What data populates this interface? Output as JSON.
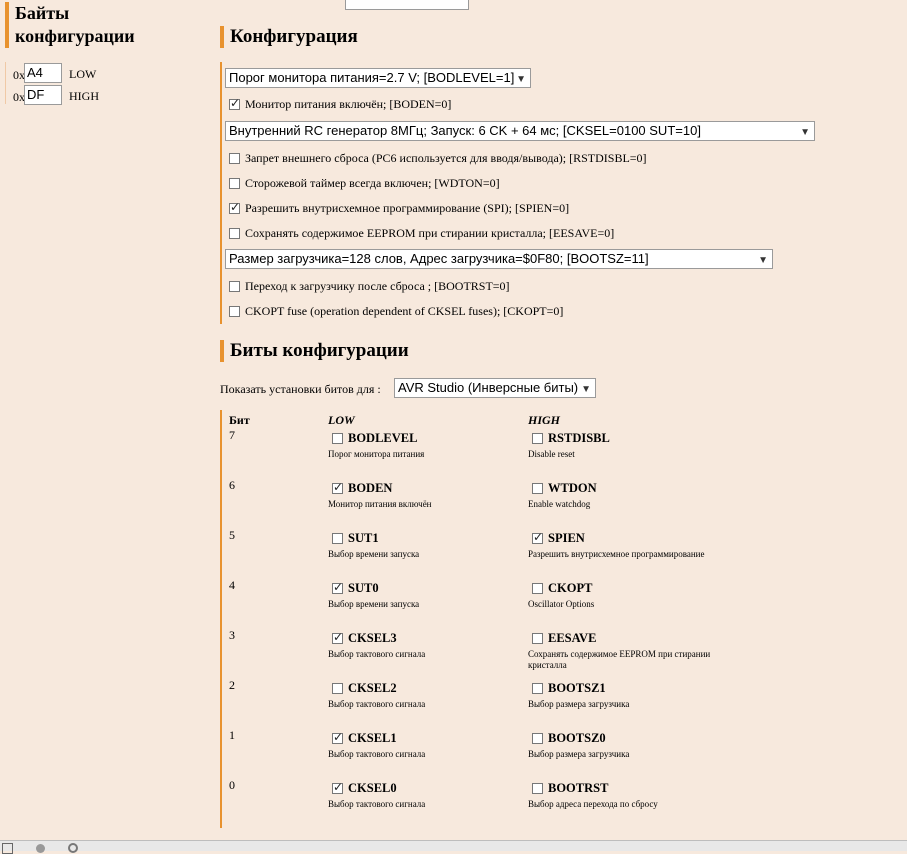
{
  "left_panel": {
    "title": "Байты конфигурации",
    "bytes": [
      {
        "prefix": "0x",
        "value": "A4",
        "label": "LOW"
      },
      {
        "prefix": "0x",
        "value": "DF",
        "label": "HIGH"
      }
    ]
  },
  "config": {
    "title": "Конфигурация",
    "bodlevel_select": "Порог монитора питания=2.7 V; [BODLEVEL=1]",
    "boden": {
      "label": "Монитор питания включён; [BODEN=0]",
      "checked": true
    },
    "cksel_select": "Внутренний RC генератор 8МГц; Запуск: 6 CK + 64 мс; [CKSEL=0100 SUT=10]",
    "rstdisbl": {
      "label": "Запрет внешнего сброса (PC6 используется для вводя/вывода); [RSTDISBL=0]",
      "checked": false
    },
    "wdton": {
      "label": "Сторожевой таймер всегда включен; [WDTON=0]",
      "checked": false
    },
    "spien": {
      "label": "Разрешить внутрисхемное программирование (SPI); [SPIEN=0]",
      "checked": true
    },
    "eesave": {
      "label": "Сохранять содержимое EEPROM при стирании кристалла; [EESAVE=0]",
      "checked": false
    },
    "bootsz_select": "Размер загрузчика=128 слов, Адрес загрузчика=$0F80; [BOOTSZ=11]",
    "bootrst": {
      "label": "Переход к загрузчику после сброса ; [BOOTRST=0]",
      "checked": false
    },
    "ckopt": {
      "label": "CKOPT fuse (operation dependent of CKSEL fuses); [CKOPT=0]",
      "checked": false
    }
  },
  "bits": {
    "title": "Биты конфигурации",
    "show_label": "Показать установки битов для :",
    "show_select": "AVR Studio (Инверсные биты)",
    "col_bit": "Бит",
    "col_low": "LOW",
    "col_high": "HIGH",
    "rows": [
      {
        "bit": "7",
        "low": {
          "name": "BODLEVEL",
          "desc": "Порог монитора питания",
          "checked": false
        },
        "high": {
          "name": "RSTDISBL",
          "desc": "Disable reset",
          "checked": false
        }
      },
      {
        "bit": "6",
        "low": {
          "name": "BODEN",
          "desc": "Монитор питания включён",
          "checked": true
        },
        "high": {
          "name": "WTDON",
          "desc": "Enable watchdog",
          "checked": false
        }
      },
      {
        "bit": "5",
        "low": {
          "name": "SUT1",
          "desc": "Выбор времени запуска",
          "checked": false
        },
        "high": {
          "name": "SPIEN",
          "desc": "Разрешить внутрисхемное программирование",
          "checked": true
        }
      },
      {
        "bit": "4",
        "low": {
          "name": "SUT0",
          "desc": "Выбор времени запуска",
          "checked": true
        },
        "high": {
          "name": "CKOPT",
          "desc": "Oscillator Options",
          "checked": false
        }
      },
      {
        "bit": "3",
        "low": {
          "name": "CKSEL3",
          "desc": "Выбор тактового сигнала",
          "checked": true
        },
        "high": {
          "name": "EESAVE",
          "desc": "Сохранять содержимое EEPROM при стирании кристалла",
          "checked": false
        }
      },
      {
        "bit": "2",
        "low": {
          "name": "CKSEL2",
          "desc": "Выбор тактового сигнала",
          "checked": false
        },
        "high": {
          "name": "BOOTSZ1",
          "desc": "Выбор размера загрузчика",
          "checked": false
        }
      },
      {
        "bit": "1",
        "low": {
          "name": "CKSEL1",
          "desc": "Выбор тактового сигнала",
          "checked": true
        },
        "high": {
          "name": "BOOTSZ0",
          "desc": "Выбор размера загрузчика",
          "checked": false
        }
      },
      {
        "bit": "0",
        "low": {
          "name": "CKSEL0",
          "desc": "Выбор тактового сигнала",
          "checked": true
        },
        "high": {
          "name": "BOOTRST",
          "desc": "Выбор адреса перехода по сбросу",
          "checked": false
        }
      }
    ]
  }
}
